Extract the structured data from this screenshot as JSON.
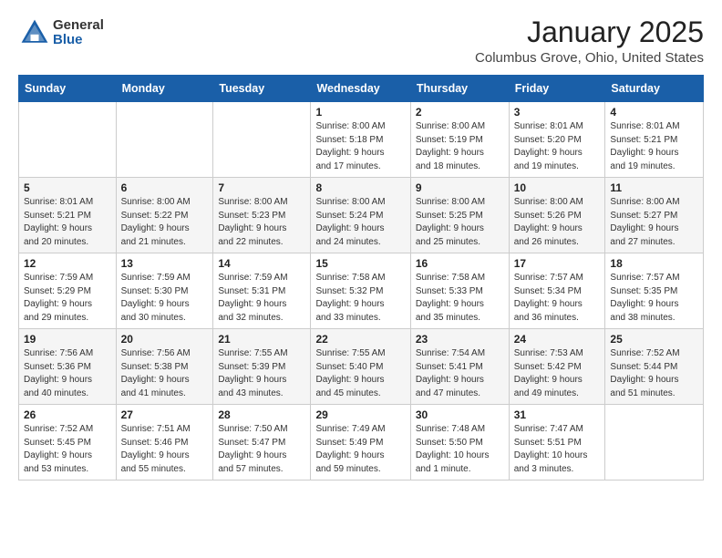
{
  "header": {
    "logo_general": "General",
    "logo_blue": "Blue",
    "month": "January 2025",
    "location": "Columbus Grove, Ohio, United States"
  },
  "weekdays": [
    "Sunday",
    "Monday",
    "Tuesday",
    "Wednesday",
    "Thursday",
    "Friday",
    "Saturday"
  ],
  "weeks": [
    [
      {
        "day": "",
        "info": ""
      },
      {
        "day": "",
        "info": ""
      },
      {
        "day": "",
        "info": ""
      },
      {
        "day": "1",
        "info": "Sunrise: 8:00 AM\nSunset: 5:18 PM\nDaylight: 9 hours\nand 17 minutes."
      },
      {
        "day": "2",
        "info": "Sunrise: 8:00 AM\nSunset: 5:19 PM\nDaylight: 9 hours\nand 18 minutes."
      },
      {
        "day": "3",
        "info": "Sunrise: 8:01 AM\nSunset: 5:20 PM\nDaylight: 9 hours\nand 19 minutes."
      },
      {
        "day": "4",
        "info": "Sunrise: 8:01 AM\nSunset: 5:21 PM\nDaylight: 9 hours\nand 19 minutes."
      }
    ],
    [
      {
        "day": "5",
        "info": "Sunrise: 8:01 AM\nSunset: 5:21 PM\nDaylight: 9 hours\nand 20 minutes."
      },
      {
        "day": "6",
        "info": "Sunrise: 8:00 AM\nSunset: 5:22 PM\nDaylight: 9 hours\nand 21 minutes."
      },
      {
        "day": "7",
        "info": "Sunrise: 8:00 AM\nSunset: 5:23 PM\nDaylight: 9 hours\nand 22 minutes."
      },
      {
        "day": "8",
        "info": "Sunrise: 8:00 AM\nSunset: 5:24 PM\nDaylight: 9 hours\nand 24 minutes."
      },
      {
        "day": "9",
        "info": "Sunrise: 8:00 AM\nSunset: 5:25 PM\nDaylight: 9 hours\nand 25 minutes."
      },
      {
        "day": "10",
        "info": "Sunrise: 8:00 AM\nSunset: 5:26 PM\nDaylight: 9 hours\nand 26 minutes."
      },
      {
        "day": "11",
        "info": "Sunrise: 8:00 AM\nSunset: 5:27 PM\nDaylight: 9 hours\nand 27 minutes."
      }
    ],
    [
      {
        "day": "12",
        "info": "Sunrise: 7:59 AM\nSunset: 5:29 PM\nDaylight: 9 hours\nand 29 minutes."
      },
      {
        "day": "13",
        "info": "Sunrise: 7:59 AM\nSunset: 5:30 PM\nDaylight: 9 hours\nand 30 minutes."
      },
      {
        "day": "14",
        "info": "Sunrise: 7:59 AM\nSunset: 5:31 PM\nDaylight: 9 hours\nand 32 minutes."
      },
      {
        "day": "15",
        "info": "Sunrise: 7:58 AM\nSunset: 5:32 PM\nDaylight: 9 hours\nand 33 minutes."
      },
      {
        "day": "16",
        "info": "Sunrise: 7:58 AM\nSunset: 5:33 PM\nDaylight: 9 hours\nand 35 minutes."
      },
      {
        "day": "17",
        "info": "Sunrise: 7:57 AM\nSunset: 5:34 PM\nDaylight: 9 hours\nand 36 minutes."
      },
      {
        "day": "18",
        "info": "Sunrise: 7:57 AM\nSunset: 5:35 PM\nDaylight: 9 hours\nand 38 minutes."
      }
    ],
    [
      {
        "day": "19",
        "info": "Sunrise: 7:56 AM\nSunset: 5:36 PM\nDaylight: 9 hours\nand 40 minutes."
      },
      {
        "day": "20",
        "info": "Sunrise: 7:56 AM\nSunset: 5:38 PM\nDaylight: 9 hours\nand 41 minutes."
      },
      {
        "day": "21",
        "info": "Sunrise: 7:55 AM\nSunset: 5:39 PM\nDaylight: 9 hours\nand 43 minutes."
      },
      {
        "day": "22",
        "info": "Sunrise: 7:55 AM\nSunset: 5:40 PM\nDaylight: 9 hours\nand 45 minutes."
      },
      {
        "day": "23",
        "info": "Sunrise: 7:54 AM\nSunset: 5:41 PM\nDaylight: 9 hours\nand 47 minutes."
      },
      {
        "day": "24",
        "info": "Sunrise: 7:53 AM\nSunset: 5:42 PM\nDaylight: 9 hours\nand 49 minutes."
      },
      {
        "day": "25",
        "info": "Sunrise: 7:52 AM\nSunset: 5:44 PM\nDaylight: 9 hours\nand 51 minutes."
      }
    ],
    [
      {
        "day": "26",
        "info": "Sunrise: 7:52 AM\nSunset: 5:45 PM\nDaylight: 9 hours\nand 53 minutes."
      },
      {
        "day": "27",
        "info": "Sunrise: 7:51 AM\nSunset: 5:46 PM\nDaylight: 9 hours\nand 55 minutes."
      },
      {
        "day": "28",
        "info": "Sunrise: 7:50 AM\nSunset: 5:47 PM\nDaylight: 9 hours\nand 57 minutes."
      },
      {
        "day": "29",
        "info": "Sunrise: 7:49 AM\nSunset: 5:49 PM\nDaylight: 9 hours\nand 59 minutes."
      },
      {
        "day": "30",
        "info": "Sunrise: 7:48 AM\nSunset: 5:50 PM\nDaylight: 10 hours\nand 1 minute."
      },
      {
        "day": "31",
        "info": "Sunrise: 7:47 AM\nSunset: 5:51 PM\nDaylight: 10 hours\nand 3 minutes."
      },
      {
        "day": "",
        "info": ""
      }
    ]
  ]
}
